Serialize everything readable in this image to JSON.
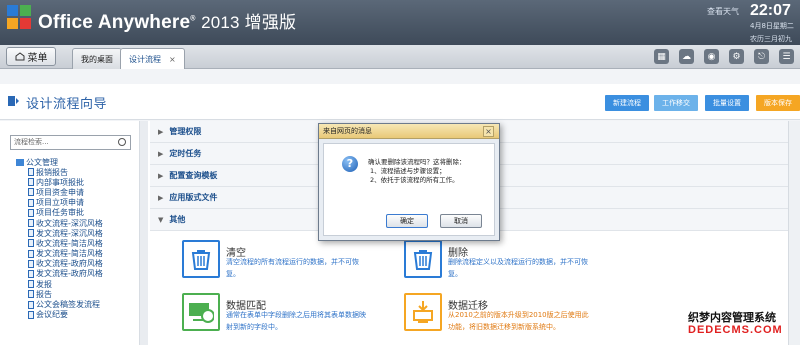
{
  "header": {
    "brand_main": "Office Anywhere",
    "brand_edition": "2013 增强版",
    "weather_link": "查看天气",
    "time": "22:07",
    "date": "4月8日星期二",
    "lunar": "农历三月初九"
  },
  "tabbar": {
    "menu_label": "菜单",
    "tabs": [
      {
        "label": "我的桌面"
      },
      {
        "label": "设计流程",
        "close": "×"
      }
    ]
  },
  "page": {
    "title": "设计流程向导",
    "buttons": [
      "新建流程",
      "工作移交",
      "批量设置",
      "版本保存"
    ]
  },
  "sidebar": {
    "search_placeholder": "流程检索...",
    "root": "公文管理",
    "items": [
      "报销报告",
      "内部事项报批",
      "项目资金申请",
      "项目立项申请",
      "项目任务审批",
      "收文流程-深沉风格",
      "发文流程-深沉风格",
      "收文流程-简洁风格",
      "发文流程-简洁风格",
      "收文流程-政府风格",
      "发文流程-政府风格",
      "发报",
      "报告",
      "公文会稿签发流程",
      "会议纪要"
    ]
  },
  "main": {
    "sections": [
      "管理权限",
      "定时任务",
      "配置查询模板",
      "应用版式文件",
      "其他"
    ],
    "cards": [
      {
        "title": "清空",
        "desc": "清空流程的所有流程运行的数据，并不可恢复。",
        "color": "blue"
      },
      {
        "title": "删除",
        "desc": "删除流程定义以及流程运行的数据，并不可恢复。",
        "color": "blue"
      },
      {
        "title": "数据匹配",
        "desc": "通常在表单中字段删除之后用将其表单数据映射到新的字段中。",
        "color": "blue"
      },
      {
        "title": "数据迁移",
        "desc": "从2010之前的版本升级到2010版之后使用此功能，将旧数据迁移到新版系统中。",
        "color": "orange"
      }
    ]
  },
  "dialog": {
    "title": "来自网页的消息",
    "close": "×",
    "message_lines": [
      "确认要删除该流程吗？这将删除：",
      "1、流程描述与步骤设置；",
      "2、依托于该流程的所有工作。"
    ],
    "ok": "确定",
    "cancel": "取消"
  },
  "watermark": {
    "line1": "织梦内容管理系统",
    "line2": "DEDECMS.COM"
  },
  "colors": {
    "accent_blue": "#3b8fe0",
    "accent_orange": "#f5a623",
    "card_blue": "#2f73c8",
    "card_orange": "#e07a12"
  }
}
